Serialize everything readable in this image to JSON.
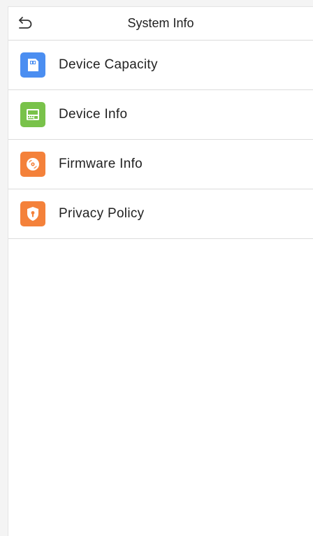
{
  "header": {
    "title": "System Info",
    "back_icon": "back-arrow-icon"
  },
  "menu": {
    "items": [
      {
        "label": "Device Capacity",
        "icon": "sd-card-icon",
        "color": "#4b8ef1"
      },
      {
        "label": "Device Info",
        "icon": "device-icon",
        "color": "#79c24a"
      },
      {
        "label": "Firmware Info",
        "icon": "disc-icon",
        "color": "#f4813a"
      },
      {
        "label": "Privacy Policy",
        "icon": "shield-lock-icon",
        "color": "#f4813a"
      }
    ]
  }
}
